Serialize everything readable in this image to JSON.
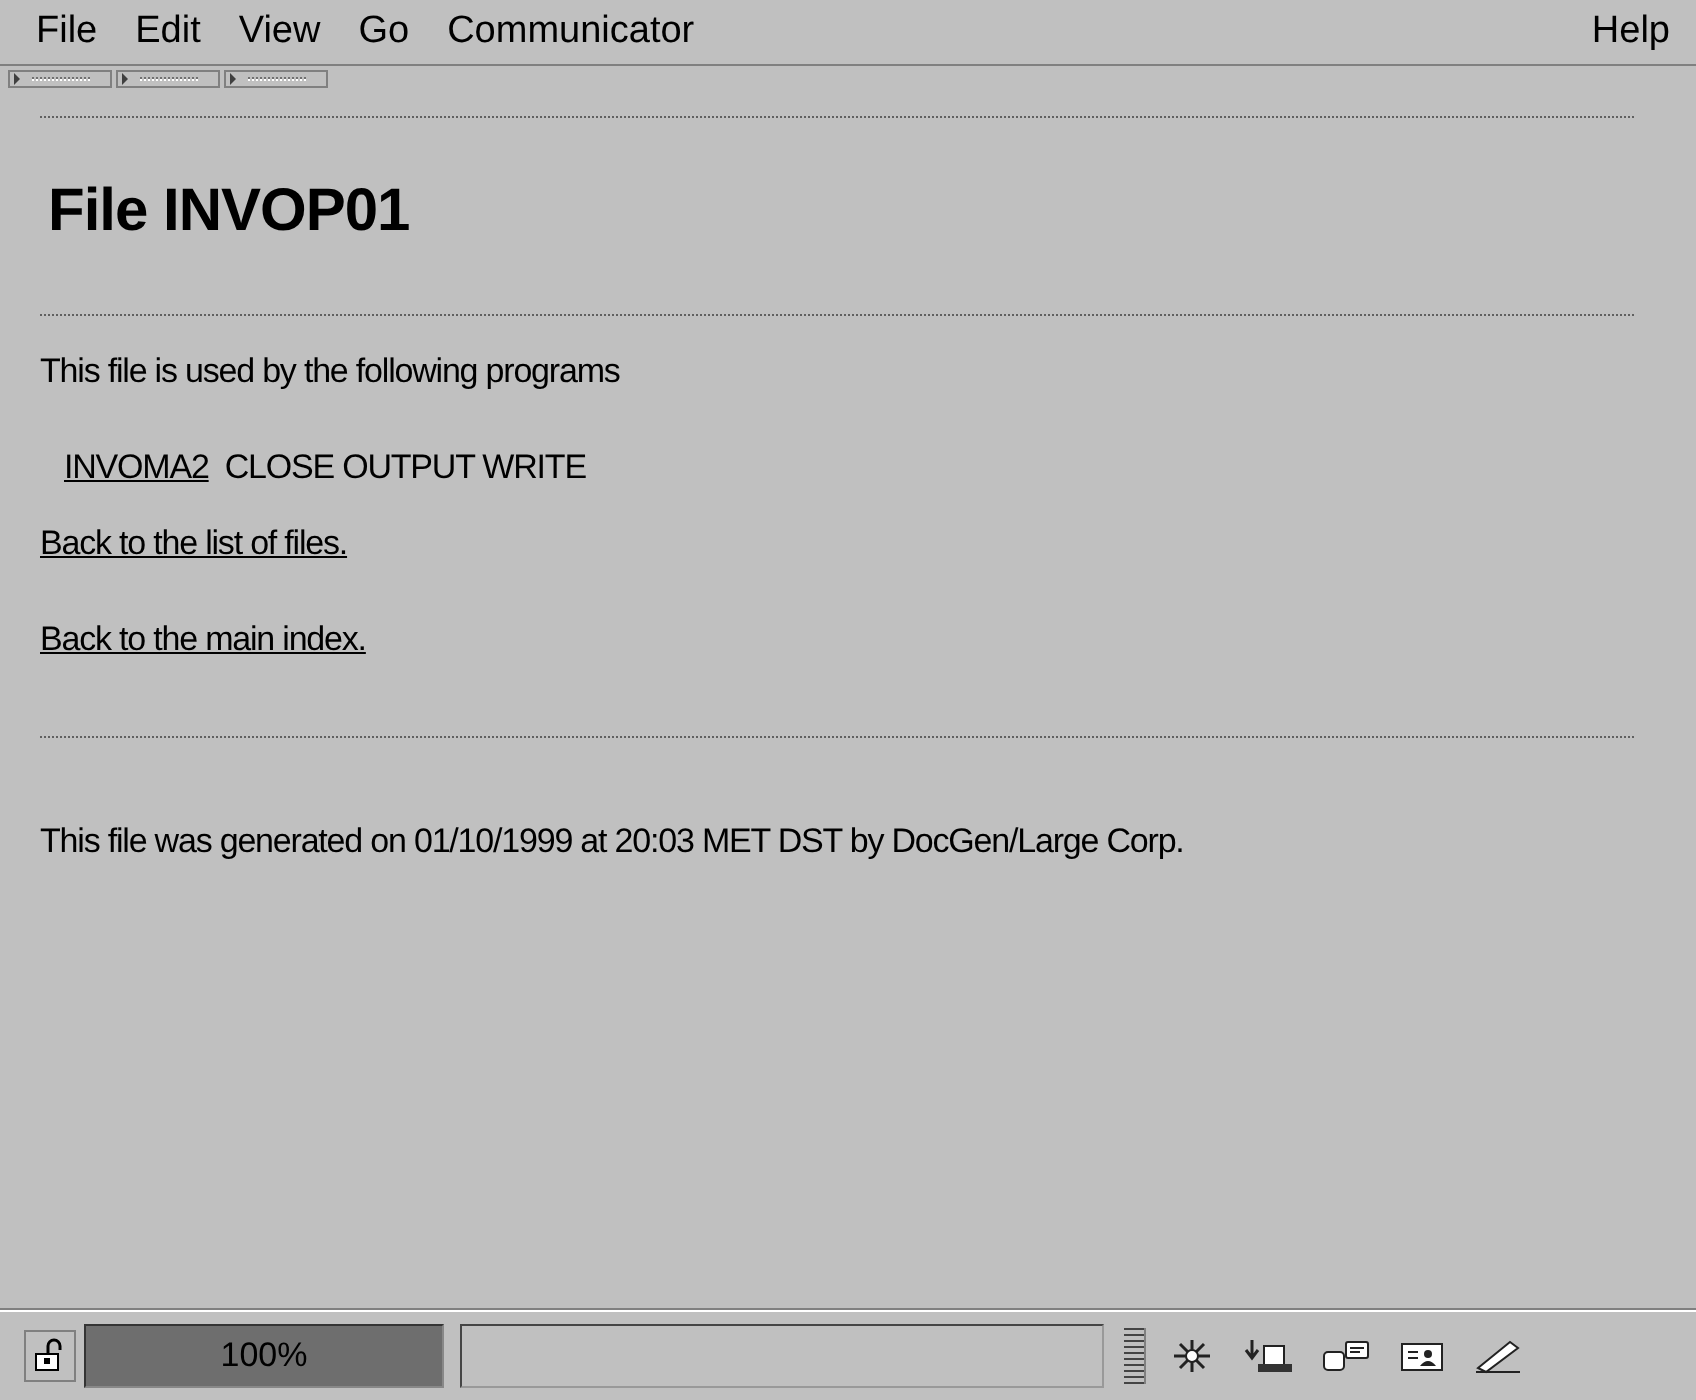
{
  "menu": [
    {
      "label": "File"
    },
    {
      "label": "Edit"
    },
    {
      "label": "View"
    },
    {
      "label": "Go"
    },
    {
      "label": "Communicator"
    }
  ],
  "help_menu": {
    "label": "Help"
  },
  "page": {
    "title": "File INVOP01",
    "intro": "This file is used by the following programs",
    "programs": [
      {
        "name": "INVOMA2",
        "operations": "CLOSE OUTPUT WRITE"
      }
    ],
    "links": [
      "Back to the list of files.",
      "Back to the main index."
    ],
    "footer": "This file was generated on 01/10/1999 at 20:03 MET DST by DocGen/Large Corp."
  },
  "status_bar": {
    "zoom": "100%"
  }
}
